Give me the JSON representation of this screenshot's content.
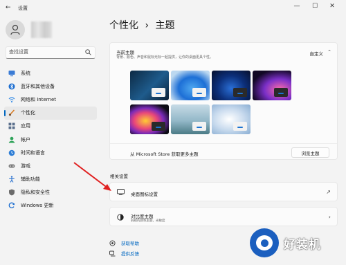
{
  "window": {
    "title": "设置",
    "controls": {
      "minimize": "—",
      "maximize": "☐",
      "close": "✕"
    }
  },
  "sidebar": {
    "search_placeholder": "查找设置",
    "items": [
      {
        "label": "系统",
        "icon": "monitor-icon",
        "color": "#3a7bd5"
      },
      {
        "label": "蓝牙和其他设备",
        "icon": "bluetooth-icon",
        "color": "#1f6fd0"
      },
      {
        "label": "网络和 Internet",
        "icon": "wifi-icon",
        "color": "#3a8ee6"
      },
      {
        "label": "个性化",
        "icon": "brush-icon",
        "color": "#d97a1f",
        "active": true
      },
      {
        "label": "应用",
        "icon": "apps-icon",
        "color": "#5a6f8c"
      },
      {
        "label": "帐户",
        "icon": "account-icon",
        "color": "#2fa35a"
      },
      {
        "label": "时间和语言",
        "icon": "globe-clock-icon",
        "color": "#2e7ed6"
      },
      {
        "label": "游戏",
        "icon": "gamepad-icon",
        "color": "#7a7a7a"
      },
      {
        "label": "辅助功能",
        "icon": "accessibility-icon",
        "color": "#2d74d0"
      },
      {
        "label": "隐私和安全性",
        "icon": "shield-icon",
        "color": "#6b6b6b"
      },
      {
        "label": "Windows 更新",
        "icon": "update-icon",
        "color": "#1f6fd0"
      }
    ]
  },
  "main": {
    "breadcrumb_parent": "个性化",
    "breadcrumb_sep": "›",
    "breadcrumb_current": "主题",
    "current_theme": {
      "title": "当前主题",
      "subtitle": "背景、颜色、声音和鼠标光标一起提供，让你的桌面更具个性。",
      "value": "自定义"
    },
    "themes": [
      {
        "name": "theme-1",
        "bg": "linear-gradient(135deg,#0d2a44,#1e5b8c 55%,#0b2036)",
        "win": "#f2f2f2"
      },
      {
        "name": "theme-2",
        "bg": "radial-gradient(ellipse at 55% 60%,#4fa8f0,#1d6fd6 45%,#bcd8f0 80%)",
        "win": "#f2f2f2"
      },
      {
        "name": "theme-3",
        "bg": "radial-gradient(ellipse at 50% 60%,#2a6fd6,#0c2f7a 50%,#070f2b)",
        "win": "#2a2a2a"
      },
      {
        "name": "theme-4",
        "bg": "radial-gradient(ellipse at 70% 65%,#ff6ea8,#7a2fc7 40%,#120824 75%)",
        "win": "#2a2a2a"
      },
      {
        "name": "theme-5",
        "bg": "radial-gradient(ellipse at 40% 55%,#ffcc33,#e8467a 35%,#7a2ab8 55%,#0c0c14 80%)",
        "win": "#2a2a2a"
      },
      {
        "name": "theme-6",
        "bg": "linear-gradient(180deg,#c7dbe6,#93b8c8 55%,#4b7b86)",
        "win": "#f2f2f2"
      },
      {
        "name": "theme-7",
        "bg": "radial-gradient(ellipse at 45% 50%,#ffffff,#c9dbee 50%,#8aaed3)",
        "win": "#f2f2f2"
      }
    ],
    "store_text": "从 Microsoft Store 获取更多主题",
    "browse_button": "浏览主题",
    "related_heading": "相关设置",
    "desktop_icons": {
      "title": "桌面图标设置",
      "end_icon": "↗"
    },
    "contrast": {
      "title": "对比度主题",
      "subtitle": "弱视的颜色主题，光敏度",
      "end_icon": "›"
    },
    "help_link": "获取帮助",
    "feedback_link": "提供反馈"
  },
  "watermark": {
    "text": "好装机"
  },
  "colors": {
    "accent": "#0067c0",
    "arrow": "#e02020",
    "background": "#f3f3f3"
  }
}
